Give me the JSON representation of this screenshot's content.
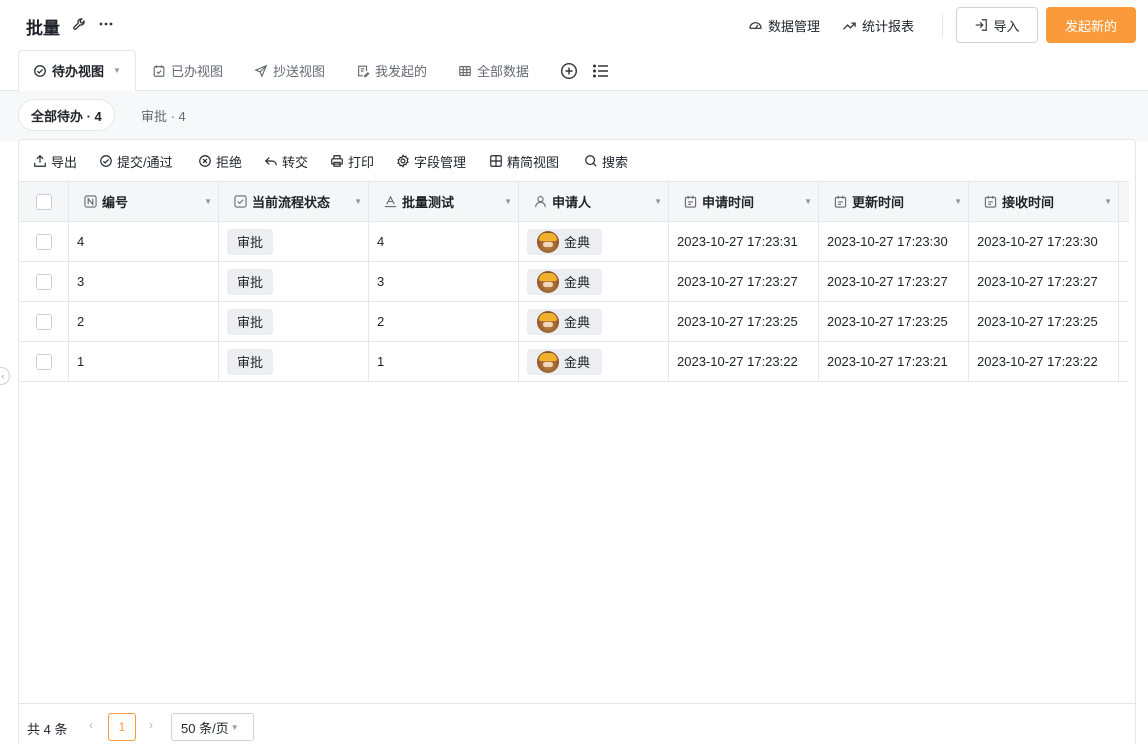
{
  "header": {
    "title": "批量",
    "data_management": "数据管理",
    "statistics_report": "统计报表",
    "import_label": "导入",
    "new_label": "发起新的"
  },
  "view_tabs": [
    {
      "label": "待办视图",
      "icon": "check-circle-icon",
      "active": true
    },
    {
      "label": "已办视图",
      "icon": "calendar-check-icon"
    },
    {
      "label": "抄送视图",
      "icon": "send-icon"
    },
    {
      "label": "我发起的",
      "icon": "edit-doc-icon"
    },
    {
      "label": "全部数据",
      "icon": "table-icon"
    }
  ],
  "filter_pills": [
    {
      "label": "全部待办 · 4",
      "active": true
    },
    {
      "label": "审批 · 4"
    }
  ],
  "toolbar": {
    "export": "导出",
    "submit": "提交/通过",
    "reject": "拒绝",
    "transfer": "转交",
    "print": "打印",
    "field_manage": "字段管理",
    "compact_view": "精简视图",
    "search": "搜索"
  },
  "table": {
    "columns": [
      "编号",
      "当前流程状态",
      "批量测试",
      "申请人",
      "申请时间",
      "更新时间",
      "接收时间"
    ],
    "rows": [
      {
        "id": "4",
        "status": "审批",
        "test": "4",
        "applicant": "金典",
        "apply_time": "2023-10-27 17:23:31",
        "update_time": "2023-10-27 17:23:30",
        "receive_time": "2023-10-27 17:23:30"
      },
      {
        "id": "3",
        "status": "审批",
        "test": "3",
        "applicant": "金典",
        "apply_time": "2023-10-27 17:23:27",
        "update_time": "2023-10-27 17:23:27",
        "receive_time": "2023-10-27 17:23:27"
      },
      {
        "id": "2",
        "status": "审批",
        "test": "2",
        "applicant": "金典",
        "apply_time": "2023-10-27 17:23:25",
        "update_time": "2023-10-27 17:23:25",
        "receive_time": "2023-10-27 17:23:25"
      },
      {
        "id": "1",
        "status": "审批",
        "test": "1",
        "applicant": "金典",
        "apply_time": "2023-10-27 17:23:22",
        "update_time": "2023-10-27 17:23:21",
        "receive_time": "2023-10-27 17:23:22"
      }
    ]
  },
  "pagination": {
    "total": "共 4 条",
    "current_page": "1",
    "page_size": "50 条/页"
  },
  "colors": {
    "accent": "#fb9a3a",
    "border": "#e5e6eb",
    "tag_bg": "#eceef1"
  }
}
